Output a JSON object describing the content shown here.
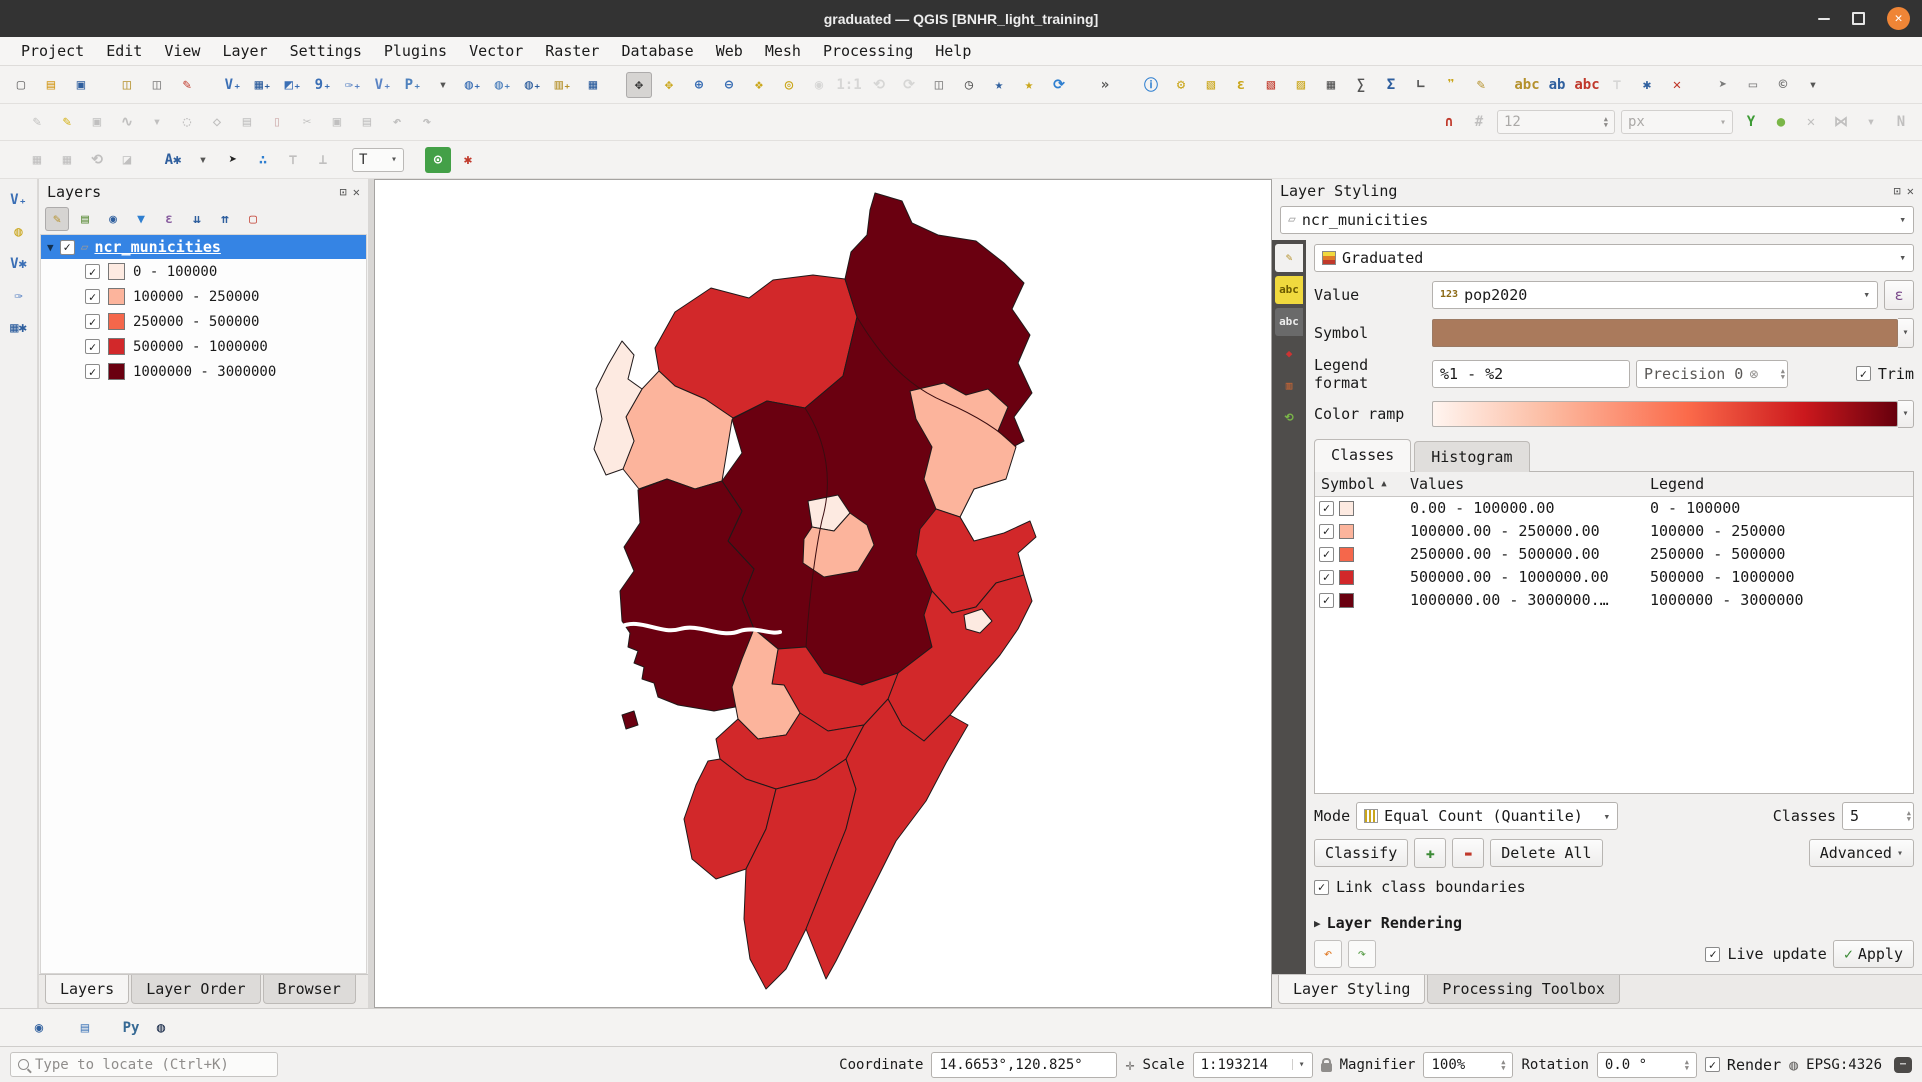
{
  "window": {
    "title": "graduated — QGIS [BNHR_light_training]"
  },
  "menu": {
    "items": [
      "Project",
      "Edit",
      "View",
      "Layer",
      "Settings",
      "Plugins",
      "Vector",
      "Raster",
      "Database",
      "Web",
      "Mesh",
      "Processing",
      "Help"
    ]
  },
  "toolbar_main": [
    {
      "n": "new-project-icon",
      "g": "▢",
      "c": "#6b6b6b"
    },
    {
      "n": "open-project-icon",
      "g": "▤",
      "c": "#d39a1e"
    },
    {
      "n": "save-project-icon",
      "g": "▣",
      "c": "#2f5f9e"
    },
    {
      "n": "new-print-layout-icon",
      "g": "◫",
      "c": "#b5912c",
      "grip": true
    },
    {
      "n": "show-layout-manager-icon",
      "g": "◫",
      "c": "#7a7a7a"
    },
    {
      "n": "style-manager-icon",
      "g": "✎",
      "c": "#c0392b"
    },
    {
      "n": "data-source-manager-icon",
      "g": "V₊",
      "c": "#3b6fb5",
      "grip": true
    },
    {
      "n": "add-raster-layer-icon",
      "g": "▦₊",
      "c": "#2f5f9e"
    },
    {
      "n": "add-mesh-layer-icon",
      "g": "◩₊",
      "c": "#3b6fb5"
    },
    {
      "n": "add-delimited-text-layer-icon",
      "g": "9₊",
      "c": "#3b6fb5"
    },
    {
      "n": "new-geopackage-layer-icon",
      "g": "✑₊",
      "c": "#5b84c4"
    },
    {
      "n": "add-spatialite-layer-icon",
      "g": "V₊",
      "c": "#5b84c4"
    },
    {
      "n": "add-postgis-layer-icon",
      "g": "P₊",
      "c": "#4f81bd"
    },
    {
      "n": "add-layer-menu-arrow-icon",
      "g": "▾",
      "c": "#555555"
    },
    {
      "n": "add-wms-layer-icon",
      "g": "◍₊",
      "c": "#3b6fb5"
    },
    {
      "n": "add-arcgis-layer-icon",
      "g": "◍₊",
      "c": "#4f81bd"
    },
    {
      "n": "add-wcs-layer-icon",
      "g": "◍₊",
      "c": "#2f5f9e"
    },
    {
      "n": "add-vector-tile-layer-icon",
      "g": "▥₊",
      "c": "#b5912c"
    },
    {
      "n": "add-virtual-layer-icon",
      "g": "▦",
      "c": "#2f5f9e"
    },
    {
      "n": "pan-map-icon",
      "g": "✥",
      "c": "#333333",
      "a": true,
      "grip": true
    },
    {
      "n": "pan-to-selection-icon",
      "g": "✥",
      "c": "#caa61b"
    },
    {
      "n": "zoom-in-icon",
      "g": "⊕",
      "c": "#3b6fb5"
    },
    {
      "n": "zoom-out-icon",
      "g": "⊖",
      "c": "#3b6fb5"
    },
    {
      "n": "zoom-full-icon",
      "g": "❖",
      "c": "#caa61b"
    },
    {
      "n": "zoom-to-selection-icon",
      "g": "◎",
      "c": "#caa61b"
    },
    {
      "n": "zoom-to-layer-icon",
      "g": "◉",
      "c": "#9a9a9a",
      "d": true
    },
    {
      "n": "zoom-native-icon",
      "g": "1:1",
      "c": "#9a9a9a",
      "d": true
    },
    {
      "n": "zoom-last-icon",
      "g": "⟲",
      "c": "#9a9a9a",
      "d": true
    },
    {
      "n": "zoom-next-icon",
      "g": "⟳",
      "c": "#9a9a9a",
      "d": true
    },
    {
      "n": "new-map-view-icon",
      "g": "◫",
      "c": "#7a7a7a"
    },
    {
      "n": "temporal-controller-icon",
      "g": "◷",
      "c": "#555555"
    },
    {
      "n": "new-spatial-bookmark-icon",
      "g": "★",
      "c": "#2f5f9e"
    },
    {
      "n": "show-spatial-bookmarks-icon",
      "g": "★",
      "c": "#caa61b"
    },
    {
      "n": "refresh-map-icon",
      "g": "⟳",
      "c": "#2f7fd0"
    },
    {
      "n": "toolbar-overflow-icon",
      "g": "»",
      "c": "#555555",
      "grip": true
    },
    {
      "n": "identify-features-icon",
      "g": "ⓘ",
      "c": "#2f7fd0",
      "grip": true
    },
    {
      "n": "run-feature-action-icon",
      "g": "⚙",
      "c": "#caa61b"
    },
    {
      "n": "select-features-icon",
      "g": "▧",
      "c": "#caa61b"
    },
    {
      "n": "select-by-expression-icon",
      "g": "ε",
      "c": "#caa61b"
    },
    {
      "n": "deselect-features-icon",
      "g": "▧",
      "c": "#c0392b"
    },
    {
      "n": "select-all-features-icon",
      "g": "▨",
      "c": "#caa61b"
    },
    {
      "n": "open-attribute-table-icon",
      "g": "▦",
      "c": "#555555"
    },
    {
      "n": "field-calculator-icon",
      "g": "∑",
      "c": "#555555"
    },
    {
      "n": "statistical-summary-icon",
      "g": "Σ",
      "c": "#2f5f9e"
    },
    {
      "n": "measure-icon",
      "g": "∟",
      "c": "#555555"
    },
    {
      "n": "map-tips-icon",
      "g": "❞",
      "c": "#caa61b"
    },
    {
      "n": "new-annotation-icon",
      "g": "✎",
      "c": "#b5912c"
    },
    {
      "n": "labeling-options-icon",
      "g": "abc",
      "c": "#b5912c",
      "grip": true
    },
    {
      "n": "label-highlight-icon",
      "g": "ab",
      "c": "#2f5f9e"
    },
    {
      "n": "label-rules-icon",
      "g": "abc",
      "c": "#c0392b"
    },
    {
      "n": "pin-labels-icon",
      "g": "⊤",
      "c": "#9a9a9a",
      "d": true
    },
    {
      "n": "decorations-icon",
      "g": "✱",
      "c": "#2f5f9e"
    },
    {
      "n": "clear-highlight-icon",
      "g": "✕",
      "c": "#c0392b"
    },
    {
      "n": "north-arrow-icon",
      "g": "➤",
      "c": "#7a7a7a",
      "grip": true
    },
    {
      "n": "scale-bar-icon",
      "g": "▭",
      "c": "#7a7a7a"
    },
    {
      "n": "copyright-label-icon",
      "g": "©",
      "c": "#7a7a7a"
    },
    {
      "n": "layout-extras-icon",
      "g": "▾",
      "c": "#555555"
    }
  ],
  "toolbar_digitize_left": [
    {
      "n": "current-edits-icon",
      "g": "✎",
      "c": "#555555",
      "d": true,
      "grip": true
    },
    {
      "n": "toggle-editing-icon",
      "g": "✎",
      "c": "#d4b013"
    },
    {
      "n": "save-layer-edits-icon",
      "g": "▣",
      "c": "#555555",
      "d": true
    },
    {
      "n": "digitize-with-segment-icon",
      "g": "∿",
      "c": "#555555",
      "d": true
    },
    {
      "n": "digitize-menu-arrow-icon",
      "g": "▾",
      "c": "#555555",
      "d": true
    },
    {
      "n": "add-record-icon",
      "g": "◌",
      "c": "#555555",
      "d": true
    },
    {
      "n": "vertex-tool-icon",
      "g": "◇",
      "c": "#555555",
      "d": true
    },
    {
      "n": "modify-attributes-icon",
      "g": "▤",
      "c": "#555555",
      "d": true
    },
    {
      "n": "delete-selected-icon",
      "g": "▯",
      "c": "#8a2c2c",
      "d": true
    },
    {
      "n": "cut-features-icon",
      "g": "✂",
      "c": "#555555",
      "d": true
    },
    {
      "n": "copy-features-icon",
      "g": "▣",
      "c": "#555555",
      "d": true
    },
    {
      "n": "paste-features-icon",
      "g": "▤",
      "c": "#555555",
      "d": true
    },
    {
      "n": "undo-icon",
      "g": "↶",
      "c": "#555555",
      "d": true
    },
    {
      "n": "redo-icon",
      "g": "↷",
      "c": "#555555",
      "d": true
    }
  ],
  "toolbar_digitize_right": [
    {
      "n": "enable-tracing-icon",
      "g": "Y",
      "c": "#3d9b35"
    },
    {
      "n": "avoid-intersections-icon",
      "g": "●",
      "c": "#7ab648"
    },
    {
      "n": "disable-snapping-icon",
      "g": "✕",
      "c": "#555555",
      "d": true
    },
    {
      "n": "topological-editing-icon",
      "g": "⋈",
      "c": "#555555",
      "d": true
    },
    {
      "n": "snapping-menu-arrow-icon",
      "g": "▾",
      "c": "#555555",
      "d": true
    },
    {
      "n": "advanced-digitize-icon",
      "g": "N",
      "c": "#555555",
      "d": true
    }
  ],
  "toolbar_snapping": [
    {
      "n": "snapping-magnet-icon",
      "g": "∩",
      "c": "#c0392b",
      "grip": true
    },
    {
      "n": "snapping-type-icon",
      "g": "#",
      "c": "#555555",
      "d": true
    }
  ],
  "toolbar_labels_left": [
    {
      "n": "layer-diagram-options-icon",
      "g": "▦",
      "c": "#555555",
      "d": true,
      "grip": true
    },
    {
      "n": "move-label-icon",
      "g": "▦",
      "c": "#555555",
      "d": true
    },
    {
      "n": "rotate-label-icon",
      "g": "⟲",
      "c": "#555555",
      "d": true
    },
    {
      "n": "change-label-properties-icon",
      "g": "◪",
      "c": "#555555",
      "d": true
    },
    {
      "n": "auto-label-icon",
      "g": "A✱",
      "c": "#2f5f9e",
      "grip": true
    },
    {
      "n": "label-menu-arrow-icon",
      "g": "▾",
      "c": "#555555"
    },
    {
      "n": "select-cursor-icon",
      "g": "➤",
      "c": "#222222"
    },
    {
      "n": "digitize-shape-icon",
      "g": "∴",
      "c": "#2f7fd0"
    },
    {
      "n": "pin-unpin-labels-icon",
      "g": "⊤",
      "c": "#555555",
      "d": true
    },
    {
      "n": "show-hidden-labels-icon",
      "g": "⊥",
      "c": "#555555",
      "d": true
    }
  ],
  "toolbar_labels_right": [
    {
      "n": "osm-place-search-icon",
      "g": "⊙",
      "c": "#ffffff",
      "bg": "#43a047",
      "grip": true
    },
    {
      "n": "plugin-tool-icon",
      "g": "✱",
      "c": "#c0392b"
    }
  ],
  "text_annotation": {
    "label": "T"
  },
  "digitize_widgets": {
    "size_value": "12",
    "unit_value": "px"
  },
  "vbar_icons": [
    {
      "n": "data-source-manager-icon",
      "g": "V₊",
      "c": "#3b6fb5"
    },
    {
      "n": "add-xyz-layer-icon",
      "g": "◍",
      "c": "#caa61b"
    },
    {
      "n": "new-shapefile-layer-icon",
      "g": "V✱",
      "c": "#3b6fb5"
    },
    {
      "n": "new-geopackage-layer-icon",
      "g": "✑",
      "c": "#5b84c4"
    },
    {
      "n": "new-virtual-layer-icon",
      "g": "▦✱",
      "c": "#2f5f9e"
    }
  ],
  "layers_panel": {
    "title": "Layers",
    "toolbar": [
      {
        "n": "open-layer-styling-icon",
        "g": "✎",
        "c": "#b5912c",
        "a": true
      },
      {
        "n": "add-group-icon",
        "g": "▤",
        "c": "#5f8f3e"
      },
      {
        "n": "manage-map-themes-icon",
        "g": "◉",
        "c": "#2f5f9e"
      },
      {
        "n": "filter-legend-icon",
        "g": "▼",
        "c": "#2f7fd0"
      },
      {
        "n": "filter-expression-icon",
        "g": "ε",
        "c": "#8a5fa0"
      },
      {
        "n": "expand-all-icon",
        "g": "⇊",
        "c": "#2f5f9e"
      },
      {
        "n": "collapse-all-icon",
        "g": "⇈",
        "c": "#2f5f9e"
      },
      {
        "n": "remove-layer-icon",
        "g": "▢",
        "c": "#c0392b"
      }
    ],
    "layer_name": "ncr_municities",
    "classes": [
      {
        "label": "0 - 100000",
        "color": "#fdeae1"
      },
      {
        "label": "100000 - 250000",
        "color": "#fcb49c"
      },
      {
        "label": "250000 - 500000",
        "color": "#f5674b"
      },
      {
        "label": "500000 - 1000000",
        "color": "#d2282a"
      },
      {
        "label": "1000000 - 3000000",
        "color": "#6a0010"
      }
    ],
    "tabs": [
      {
        "label": "Layers",
        "a": true
      },
      {
        "label": "Layer Order"
      },
      {
        "label": "Browser"
      }
    ]
  },
  "styling_panel": {
    "title": "Layer Styling",
    "layer_selector": "ncr_municities",
    "strip_icons": [
      {
        "n": "symbology-tab-icon",
        "g": "✎",
        "c": "#b5912c",
        "a": true
      },
      {
        "n": "labels-tab-icon",
        "g": "abc",
        "c": "#6b5a00",
        "bg": "#f0d93e"
      },
      {
        "n": "masks-tab-icon",
        "g": "abc",
        "c": "#eeeeee",
        "bg": "#6a6a6a"
      },
      {
        "n": "view-3d-tab-icon",
        "g": "◆",
        "c": "#cc3333"
      },
      {
        "n": "diagrams-tab-icon",
        "g": "▥",
        "c": "#cc6633"
      },
      {
        "n": "history-tab-icon",
        "g": "⟲",
        "c": "#7ab648"
      }
    ],
    "renderer": "Graduated",
    "value_label": "Value",
    "value": "pop2020",
    "value_badge": "123",
    "expression_button": "ε",
    "symbol_label": "Symbol",
    "symbol_color": "#aa7a5c",
    "legend_format_label": "Legend format",
    "legend_format": "%1 - %2",
    "precision_text": "Precision 0",
    "trim_label": "Trim",
    "color_ramp_label": "Color ramp",
    "tabs": [
      {
        "label": "Classes",
        "a": true
      },
      {
        "label": "Histogram"
      }
    ],
    "table": {
      "headers": {
        "symbol": "Symbol",
        "values": "Values",
        "legend": "Legend"
      },
      "rows": [
        {
          "color": "#fdeae1",
          "values": "0.00 - 100000.00",
          "legend": "0 - 100000"
        },
        {
          "color": "#fcb49c",
          "values": "100000.00 - 250000.00",
          "legend": "100000 - 250000"
        },
        {
          "color": "#f5674b",
          "values": "250000.00 - 500000.00",
          "legend": "250000 - 500000"
        },
        {
          "color": "#d2282a",
          "values": "500000.00 - 1000000.00",
          "legend": "500000 - 1000000"
        },
        {
          "color": "#6a0010",
          "values": "1000000.00 - 3000000.…",
          "legend": "1000000 - 3000000"
        }
      ]
    },
    "mode_label": "Mode",
    "mode": "Equal Count (Quantile)",
    "classes_label": "Classes",
    "classes_count": "5",
    "classify_label": "Classify",
    "add_class_label": "✚",
    "remove_class_label": "▬",
    "delete_all_label": "Delete All",
    "advanced_label": "Advanced",
    "link_label": "Link class boundaries",
    "layer_rendering_label": "Layer Rendering",
    "live_update_label": "Live update",
    "apply_label": "Apply",
    "tabs_bottom": [
      {
        "label": "Layer Styling",
        "a": true
      },
      {
        "label": "Processing Toolbox"
      }
    ]
  },
  "plugins_toolbar": [
    {
      "n": "metasearch-icon",
      "g": "◉",
      "c": "#2f5f9e",
      "grip": true
    },
    {
      "n": "db-manager-icon",
      "g": "▤",
      "c": "#4f81bd",
      "grip": true
    },
    {
      "n": "python-console-icon",
      "g": "Py",
      "c": "#366994",
      "grip": true
    },
    {
      "n": "quickmap-services-icon",
      "g": "◍",
      "c": "#1a2b4a"
    }
  ],
  "status_bar": {
    "locate_placeholder": "Type to locate (Ctrl+K)",
    "coordinate_label": "Coordinate",
    "coordinate_value": "14.6653°,120.825°",
    "scale_label": "Scale",
    "scale_value": "1:193214",
    "magnifier_label": "Magnifier",
    "magnifier_value": "100%",
    "rotation_label": "Rotation",
    "rotation_value": "0.0 °",
    "render_label": "Render",
    "crs_label": "EPSG:4326"
  },
  "map": {
    "class_colors": [
      "#fdeae1",
      "#fcb49c",
      "#f5674b",
      "#d2282a",
      "#6a0010"
    ]
  }
}
